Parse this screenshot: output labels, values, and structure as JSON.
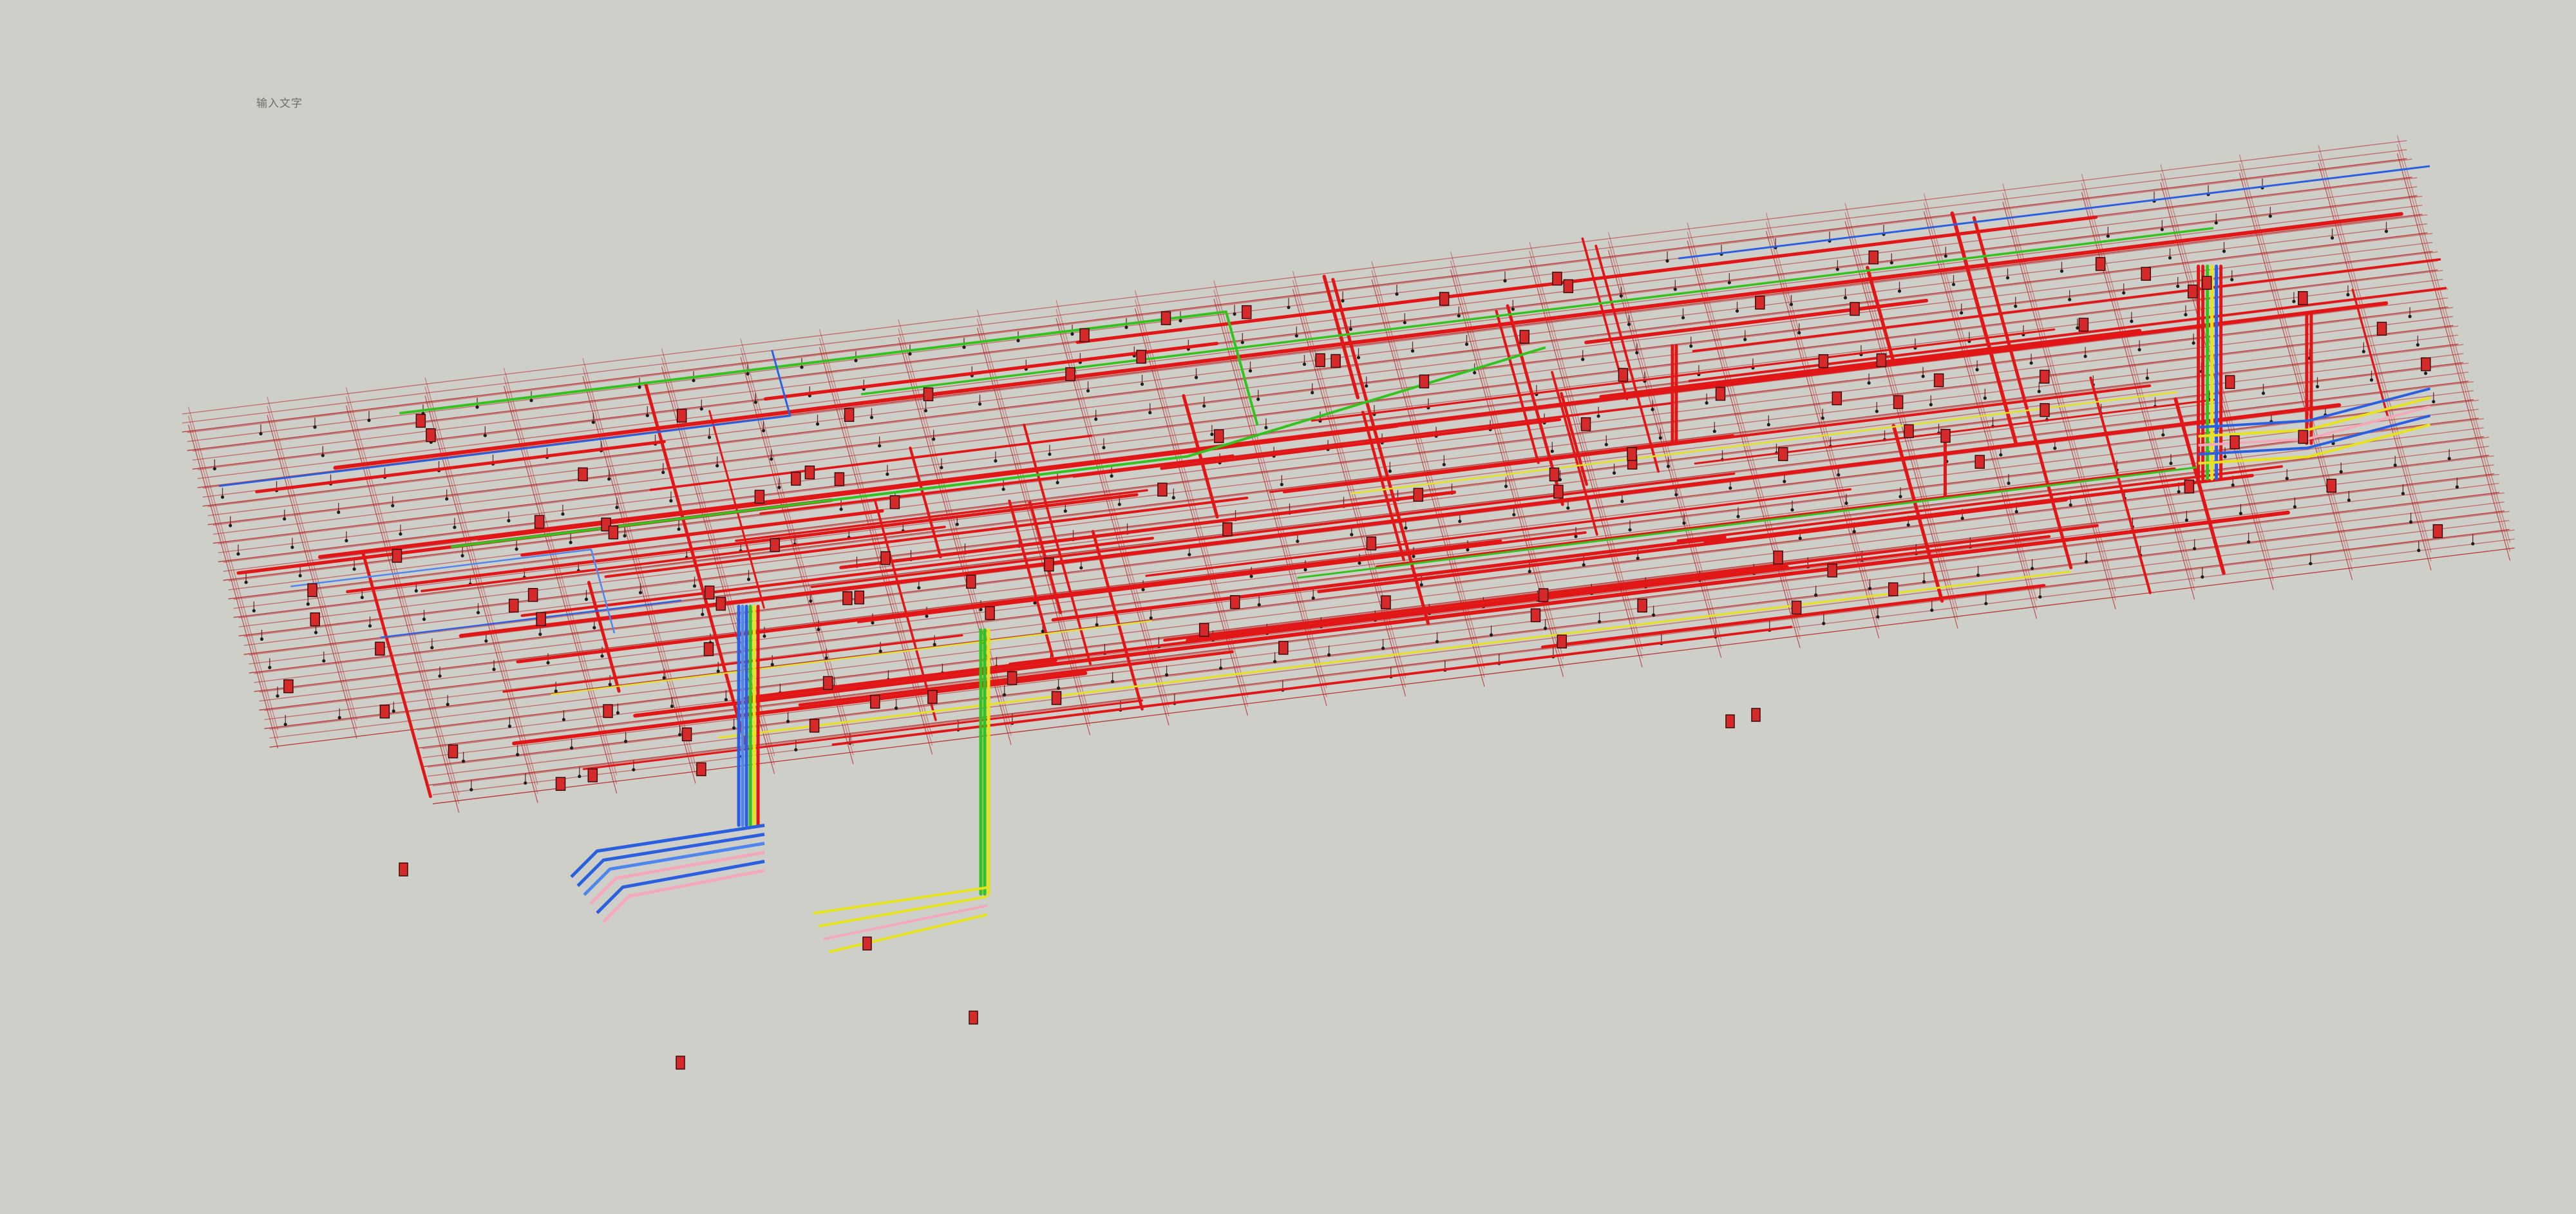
{
  "canvas": {
    "background": "#cfcfca",
    "text_label": "输入文字"
  },
  "colors": {
    "sprinkler_main": "#e11717",
    "sprinkler_branch": "#b32424",
    "drop": "#5a1a1a",
    "supply": "#2a5fe0",
    "supply_light": "#4f86ee",
    "drain": "#34c21e",
    "gas": "#e6e21b",
    "pink": "#f3a9b9",
    "valve": "#d62a2a"
  },
  "scene": {
    "floor_slab": "iso-grid",
    "risers": [
      {
        "name": "riser-west",
        "colors": [
          "supply",
          "supply_light",
          "drain",
          "gas",
          "sprinkler_main"
        ]
      },
      {
        "name": "riser-center-west",
        "colors": [
          "drain",
          "drain",
          "gas"
        ]
      },
      {
        "name": "riser-east",
        "colors": [
          "sprinkler_main",
          "drain",
          "gas",
          "supply",
          "sprinkler_main"
        ]
      }
    ],
    "equipment": "fire-hydrant-box"
  }
}
